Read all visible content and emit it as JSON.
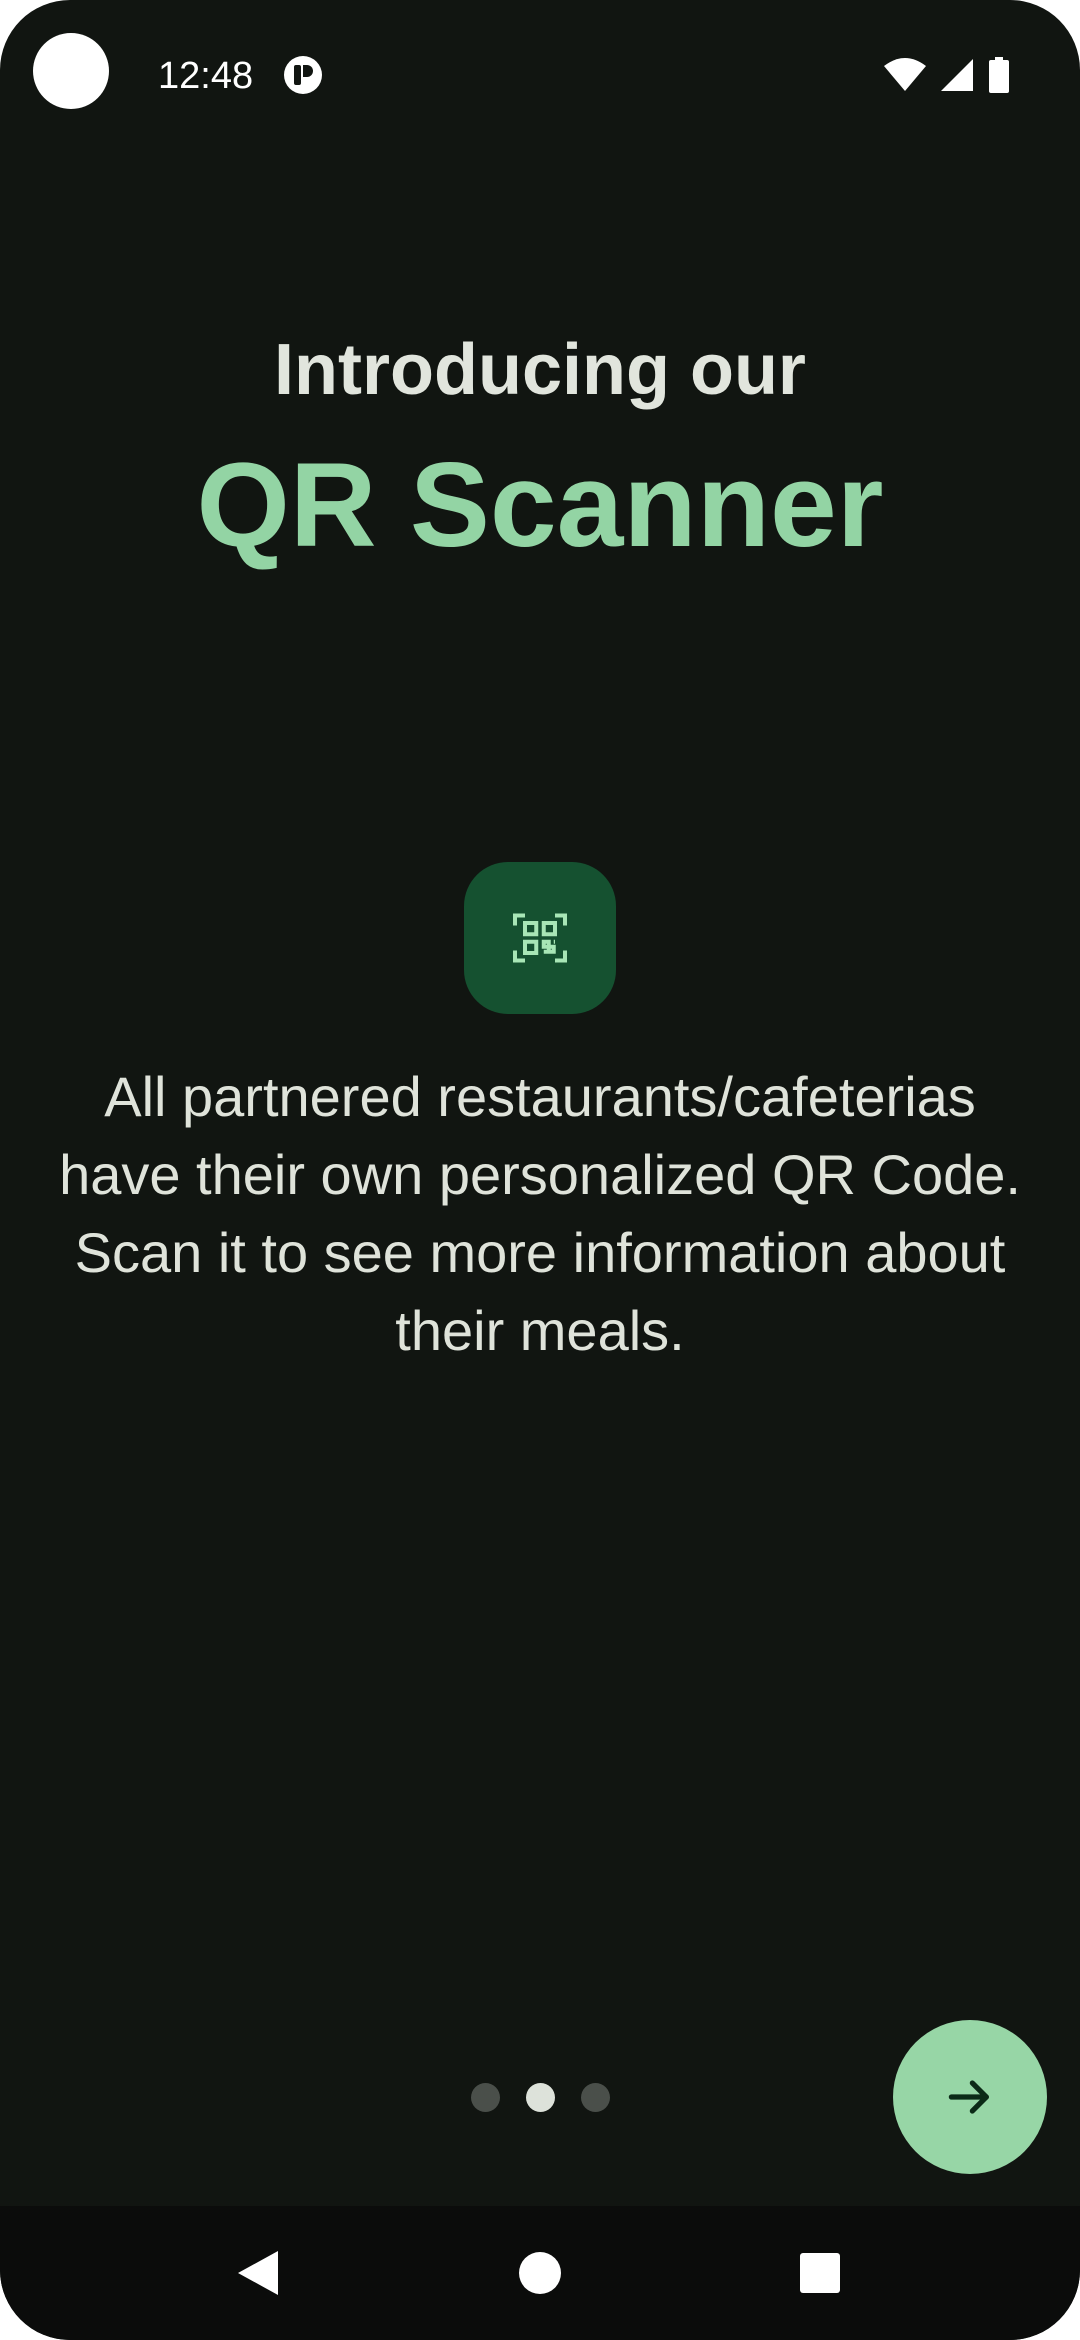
{
  "status_bar": {
    "time": "12:48",
    "icons": [
      "camera-cutout",
      "app-notification-icon",
      "wifi-icon",
      "signal-icon",
      "battery-icon"
    ]
  },
  "onboarding": {
    "intro": "Introducing our",
    "title": "QR Scanner",
    "feature_icon": "qr-code-scanner-icon",
    "description": [
      "All partnered restaurants/cafeterias have their own personalized QR Code.",
      "Scan it to see more information about their meals."
    ]
  },
  "pager": {
    "total": 3,
    "active_index": 1
  },
  "next_button": {
    "icon": "arrow-right-icon"
  },
  "nav_bar": {
    "buttons": [
      "back-icon",
      "home-icon",
      "recents-icon"
    ]
  },
  "colors": {
    "background": "#111511",
    "title_accent": "#93d4a4",
    "icon_tile": "#155130",
    "fab": "#97d6a6",
    "text": "#e1e5dd"
  }
}
